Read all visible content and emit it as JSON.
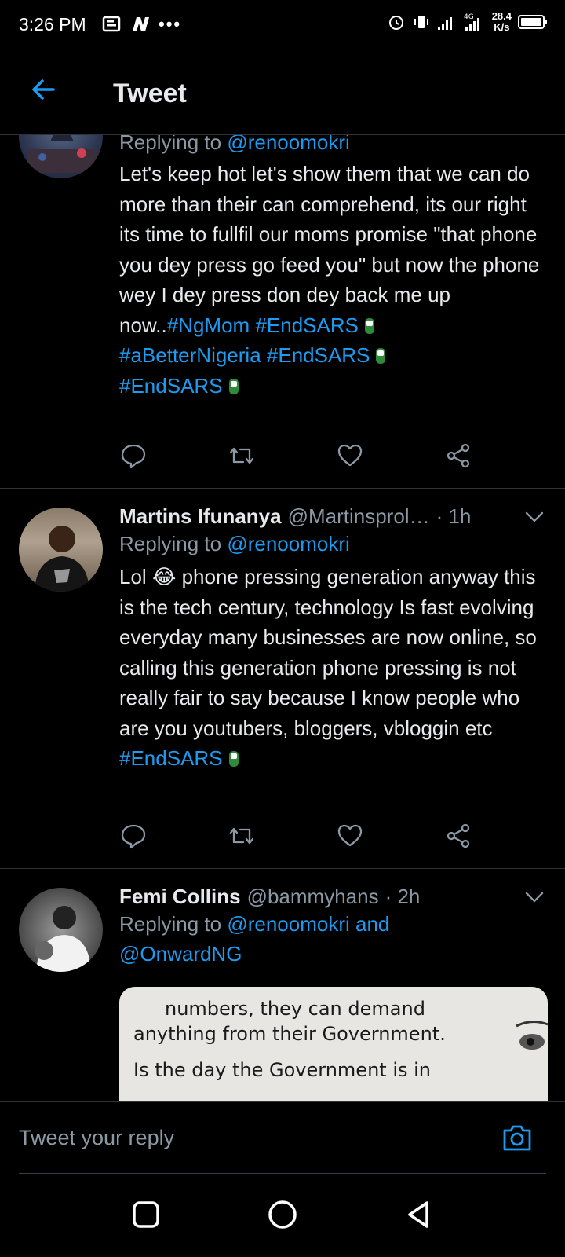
{
  "status_bar": {
    "time": "3:26 PM",
    "net_speed_value": "28.4",
    "net_speed_unit": "K/s",
    "network": "4G"
  },
  "header": {
    "title": "Tweet"
  },
  "tweets": [
    {
      "reply_label": "Replying to",
      "reply_to": "@renoomokri",
      "body": "Let's keep hot let's show them that we can do more than their can comprehend, its our right its time to fullfil our moms promise \"that phone you dey  press  go feed you\" but now the phone wey I dey press don dey back me up now..",
      "hashtags": [
        "#NgMom",
        "#EndSARS",
        "#aBetterNigeria",
        "#EndSARS",
        "#EndSARS"
      ]
    },
    {
      "name": "Martins Ifunanya",
      "handle": "@Martinsprol…",
      "time": "· 1h",
      "reply_label": "Replying to",
      "reply_to": "@renoomokri",
      "body_prefix": "Lol",
      "emoji": "😂",
      "body": "phone pressing generation anyway this is the tech century, technology Is fast evolving everyday many businesses are now online, so calling this generation phone pressing is not really fair to say because I know people who are you youtubers, bloggers, vbloggin etc",
      "hashtags": [
        "#EndSARS"
      ]
    },
    {
      "name": "Femi Collins",
      "handle": "@bammyhans",
      "time": "· 2h",
      "reply_label": "Replying to",
      "reply_to": "@renoomokri and",
      "reply_to_2": "@OnwardNG",
      "media_line1": "numbers, they can demand",
      "media_line2": "anything from their Government.",
      "media_line3": "Is the day the Government is in"
    }
  ],
  "composer": {
    "placeholder": "Tweet your reply"
  },
  "icons": [
    "back-arrow-icon",
    "reply-icon",
    "retweet-icon",
    "like-icon",
    "share-icon",
    "chevron-down-icon",
    "camera-icon",
    "fist-emoji-icon",
    "alarm-icon",
    "vibrate-icon",
    "signal-icon",
    "battery-icon",
    "nav-recents-icon",
    "nav-home-icon",
    "nav-back-icon"
  ],
  "colors": {
    "background": "#000000",
    "accent": "#1d9bf0",
    "secondary_text": "#8b98a5",
    "primary_text": "#e7e9ea",
    "divider": "#2f3336"
  }
}
